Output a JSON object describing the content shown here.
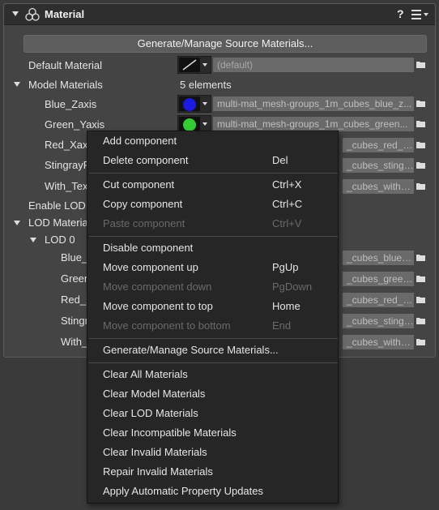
{
  "panel": {
    "title": "Material",
    "help_label": "?",
    "icons": {
      "collapse": "triangle-down-icon",
      "component": "material-component-icon",
      "menu": "hamburger-menu-icon"
    }
  },
  "generate_button": "Generate/Manage Source Materials...",
  "default_material": {
    "label": "Default Material",
    "value": "(default)"
  },
  "model_materials": {
    "label": "Model Materials",
    "count_text": "5 elements",
    "items": [
      {
        "label": "Blue_Zaxis",
        "color": "#1a1ae0",
        "path": "multi-mat_mesh-groups_1m_cubes_blue_z..."
      },
      {
        "label": "Green_Yaxis",
        "color": "#33cc33",
        "path": "multi-mat_mesh-groups_1m_cubes_green..."
      },
      {
        "label": "Red_Xaxis",
        "path": "_cubes_red_xa..."
      },
      {
        "label": "StingrayP",
        "path": "_cubes_stingr..."
      },
      {
        "label": "With_Text",
        "path": "_cubes_with_t..."
      }
    ]
  },
  "enable_lod": {
    "label": "Enable LOD M"
  },
  "lod_materials": {
    "label": "LOD Materia",
    "lod0": {
      "label": "LOD 0",
      "items": [
        {
          "label": "Blue_Z",
          "path": "_cubes_blue_z..."
        },
        {
          "label": "Greer",
          "path": "_cubes_green..."
        },
        {
          "label": "Red_X",
          "path": "_cubes_red_xa..."
        },
        {
          "label": "Stingr",
          "path": "_cubes_stingr..."
        },
        {
          "label": "With_T",
          "path": "_cubes_with_t..."
        }
      ]
    }
  },
  "context_menu": {
    "items": [
      {
        "label": "Add component",
        "shortcut": "",
        "enabled": true
      },
      {
        "label": "Delete component",
        "shortcut": "Del",
        "enabled": true
      },
      {
        "label": "Cut component",
        "shortcut": "Ctrl+X",
        "enabled": true
      },
      {
        "label": "Copy component",
        "shortcut": "Ctrl+C",
        "enabled": true
      },
      {
        "label": "Paste component",
        "shortcut": "Ctrl+V",
        "enabled": false
      },
      {
        "label": "Disable component",
        "shortcut": "",
        "enabled": true
      },
      {
        "label": "Move component up",
        "shortcut": "PgUp",
        "enabled": true
      },
      {
        "label": "Move component down",
        "shortcut": "PgDown",
        "enabled": false
      },
      {
        "label": "Move component to top",
        "shortcut": "Home",
        "enabled": true
      },
      {
        "label": "Move component to bottom",
        "shortcut": "End",
        "enabled": false
      },
      {
        "label": "Generate/Manage Source Materials...",
        "shortcut": "",
        "enabled": true
      },
      {
        "label": "Clear All Materials",
        "shortcut": "",
        "enabled": true
      },
      {
        "label": "Clear Model Materials",
        "shortcut": "",
        "enabled": true
      },
      {
        "label": "Clear LOD Materials",
        "shortcut": "",
        "enabled": true
      },
      {
        "label": "Clear Incompatible Materials",
        "shortcut": "",
        "enabled": true
      },
      {
        "label": "Clear Invalid Materials",
        "shortcut": "",
        "enabled": true
      },
      {
        "label": "Repair Invalid Materials",
        "shortcut": "",
        "enabled": true
      },
      {
        "label": "Apply Automatic Property Updates",
        "shortcut": "",
        "enabled": true
      }
    ]
  }
}
